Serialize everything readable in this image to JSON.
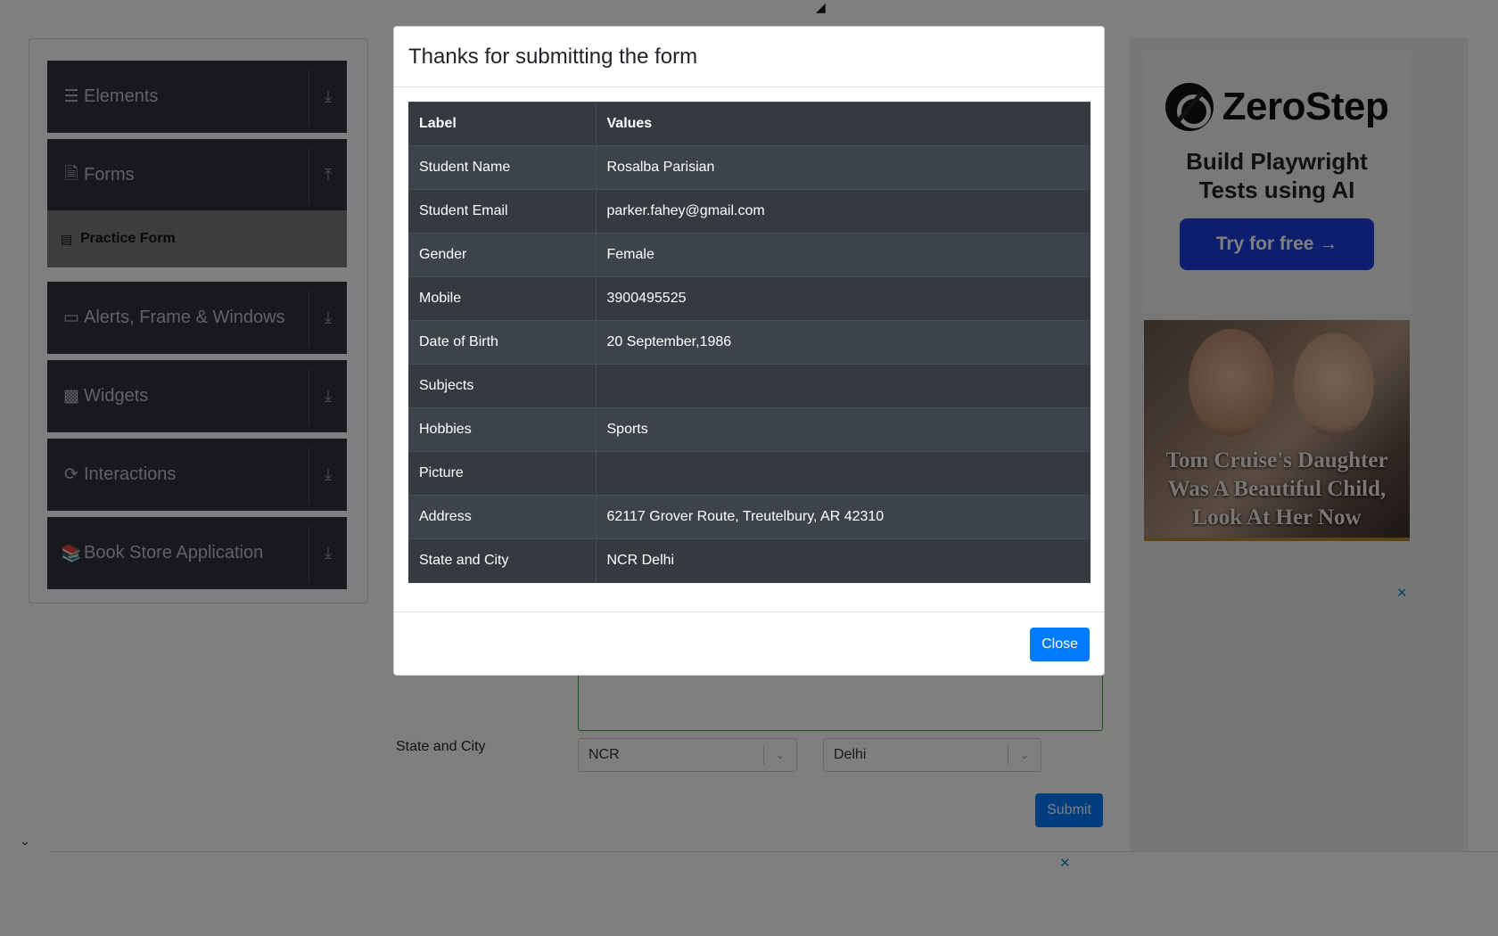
{
  "sidebar": {
    "groups": [
      {
        "label": "Elements",
        "icon": "menu-icon",
        "toggle": "expand"
      },
      {
        "label": "Forms",
        "icon": "document-icon",
        "toggle": "collapse"
      },
      {
        "label": "Alerts, Frame & Windows",
        "icon": "window-icon",
        "toggle": "expand"
      },
      {
        "label": "Widgets",
        "icon": "widgets-icon",
        "toggle": "expand"
      },
      {
        "label": "Interactions",
        "icon": "interaction-icon",
        "toggle": "expand"
      },
      {
        "label": "Book Store Application",
        "icon": "books-icon",
        "toggle": "expand"
      }
    ],
    "active_item": "Practice Form"
  },
  "form": {
    "state_city_label": "State and City",
    "state_value": "NCR",
    "city_value": "Delhi",
    "submit_label": "Submit"
  },
  "ads": {
    "zerostep": {
      "name": "ZeroStep",
      "tagline": "Build Playwright Tests using AI",
      "cta": "Try for free →"
    },
    "photo_caption": "Tom Cruise's Daughter Was A Beautiful Child, Look At Her Now",
    "close_glyph": "✕"
  },
  "modal": {
    "title": "Thanks for submitting the form",
    "headers": [
      "Label",
      "Values"
    ],
    "rows": [
      {
        "label": "Student Name",
        "value": "Rosalba Parisian"
      },
      {
        "label": "Student Email",
        "value": "parker.fahey@gmail.com"
      },
      {
        "label": "Gender",
        "value": "Female"
      },
      {
        "label": "Mobile",
        "value": "3900495525"
      },
      {
        "label": "Date of Birth",
        "value": "20 September,1986"
      },
      {
        "label": "Subjects",
        "value": ""
      },
      {
        "label": "Hobbies",
        "value": "Sports"
      },
      {
        "label": "Picture",
        "value": ""
      },
      {
        "label": "Address",
        "value": "62117 Grover Route, Treutelbury, AR 42310"
      },
      {
        "label": "State and City",
        "value": "NCR Delhi"
      }
    ],
    "close_label": "Close"
  },
  "colors": {
    "overlay": "rgba(0,0,0,0.5)",
    "table_dark": "#343a40",
    "primary": "#007bff",
    "sidebar_group": "#2f3339",
    "ad_button": "#1a3dd9"
  }
}
